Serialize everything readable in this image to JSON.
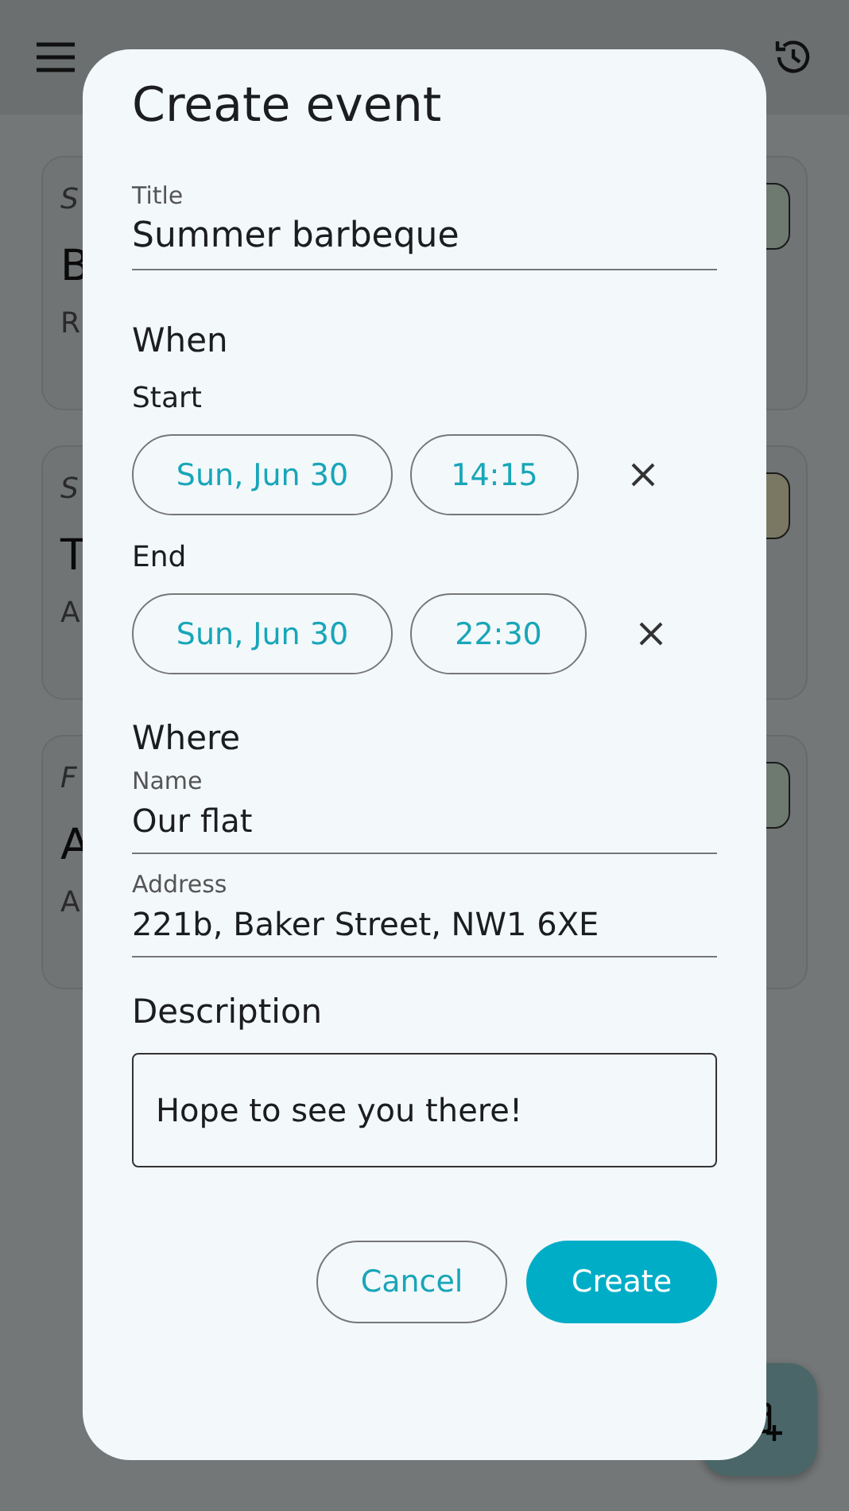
{
  "cards": [
    {
      "day": "S",
      "title": "B",
      "subtitle": "R",
      "color": "#6e7a70"
    },
    {
      "day": "S",
      "title": "T",
      "subtitle": "A",
      "color": "#7a7863"
    },
    {
      "day": "F",
      "title": "A",
      "subtitle": "A",
      "color": "#6e7a70"
    }
  ],
  "dialog": {
    "title": "Create event",
    "title_field": {
      "label": "Title",
      "value": "Summer barbeque"
    },
    "when": {
      "heading": "When",
      "rows": [
        {
          "label": "Start",
          "date": "Sun, Jun 30",
          "time": "14:15"
        },
        {
          "label": "End",
          "date": "Sun, Jun 30",
          "time": "22:30"
        }
      ]
    },
    "where": {
      "heading": "Where",
      "fields": [
        {
          "label": "Name",
          "value": "Our flat"
        },
        {
          "label": "Address",
          "value": "221b, Baker Street, NW1 6XE"
        }
      ]
    },
    "description": {
      "heading": "Description",
      "value": "Hope to see you there!"
    },
    "buttons": [
      {
        "label": "Cancel",
        "kind": "outlined"
      },
      {
        "label": "Create",
        "kind": "filled"
      }
    ]
  }
}
